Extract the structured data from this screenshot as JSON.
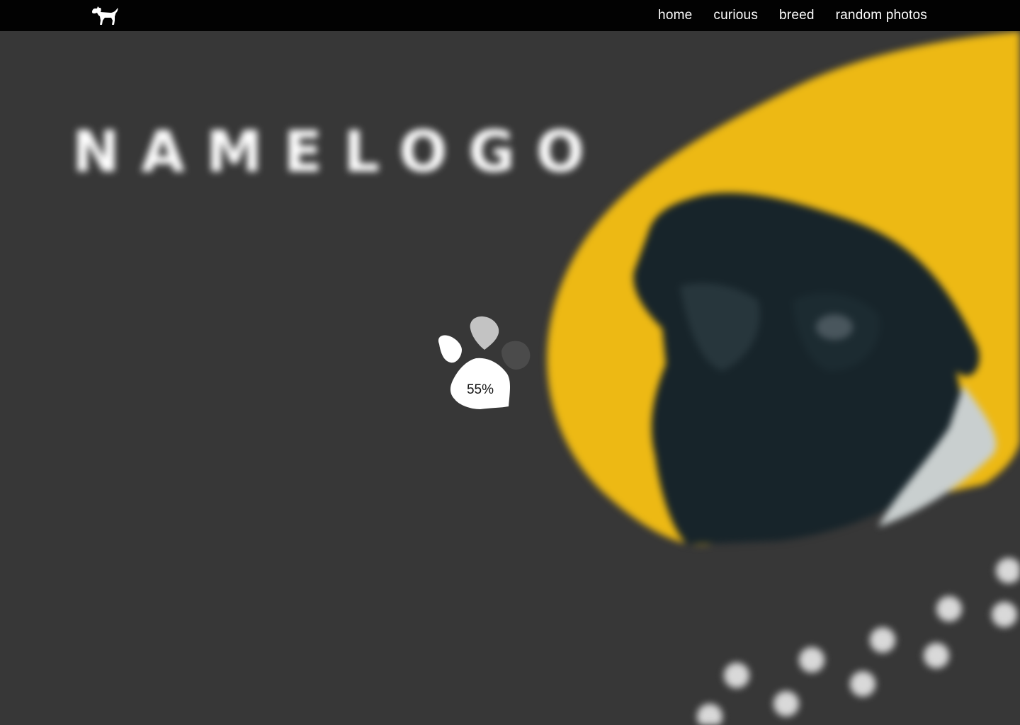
{
  "navbar": {
    "brand_icon": "dog-icon",
    "links": [
      {
        "label": "home"
      },
      {
        "label": "curious"
      },
      {
        "label": "breed"
      },
      {
        "label": "random photos"
      }
    ]
  },
  "hero": {
    "logo_text": "NAMELOGO",
    "tagline": "",
    "image_subject": "pug-icon",
    "footprints_icon": "paw-print-icon"
  },
  "loader": {
    "progress_label": "55%",
    "progress": 0.55,
    "icon": "paw-icon"
  },
  "colors": {
    "background": "#373737",
    "navbar": "#020202",
    "accent": "#EDB914",
    "text": "#FFFFFF"
  }
}
